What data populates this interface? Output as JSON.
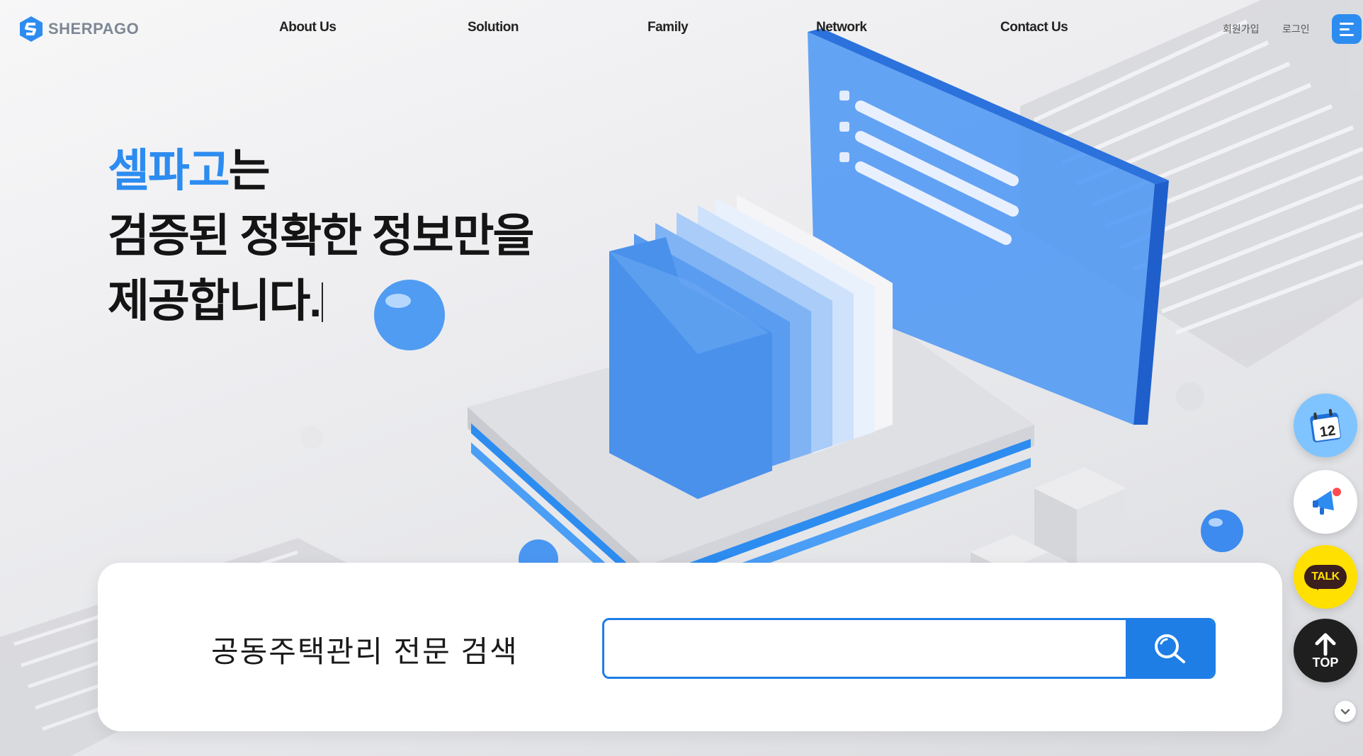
{
  "brand": {
    "name": "SHERPAGO",
    "color": "#2d8cf0",
    "logo_icon": "sherpago-logo-icon"
  },
  "nav": {
    "items": [
      {
        "label": "About Us"
      },
      {
        "label": "Solution"
      },
      {
        "label": "Family"
      },
      {
        "label": "Network"
      },
      {
        "label": "Contact Us"
      }
    ],
    "signup_label": "회원가입",
    "login_label": "로그인",
    "menu_icon": "hamburger-menu-icon"
  },
  "hero": {
    "brand_word": "셀파고",
    "line1_rest": "는",
    "line2": "검증된 정확한 정보만을",
    "line3": "제공합니다."
  },
  "search": {
    "label": "공동주택관리 전문 검색",
    "placeholder": "",
    "value": "",
    "button_icon": "search-icon",
    "accent": "#1e7ee6"
  },
  "quick_menu": {
    "calendar_icon": "calendar-icon",
    "calendar_day": "12",
    "notification_icon": "megaphone-icon",
    "talk_label": "TALK",
    "top_label": "TOP",
    "scroll_icon": "chevron-down-icon"
  }
}
